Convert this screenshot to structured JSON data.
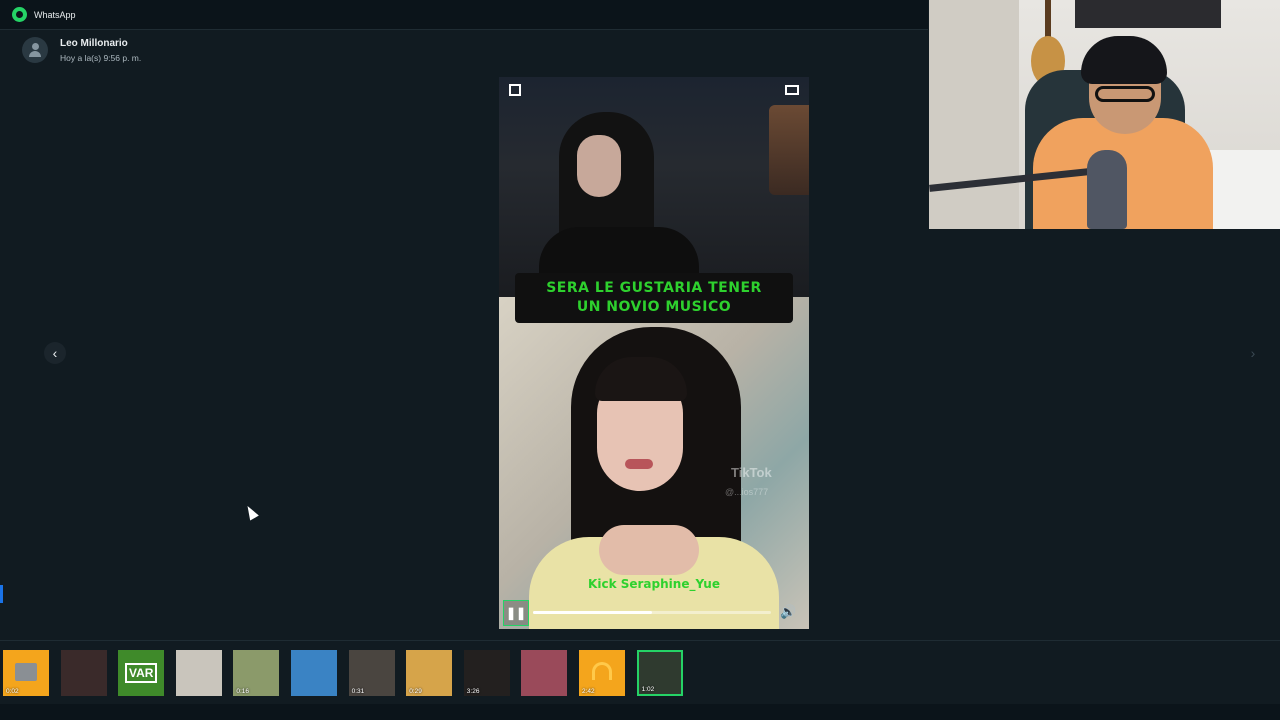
{
  "app": {
    "title": "WhatsApp"
  },
  "sender": {
    "name": "Leo Millonario",
    "time": "Hoy a la(s) 9:56 p. m."
  },
  "nav": {
    "prev_symbol": "‹",
    "next_symbol": "›"
  },
  "video": {
    "caption_line1": "SERA LE GUSTARIA TENER",
    "caption_line2": "UN NOVIO MUSICO",
    "watermark": "TikTok",
    "watermark_user": "@...ios777",
    "overlay_text": "Kick Seraphine_Yue",
    "playing": true,
    "progress": 0.5,
    "pause_symbol": "❚❚",
    "volume_symbol": "🔊"
  },
  "thumbnails": [
    {
      "kind": "image",
      "duration": "0:02",
      "color": "#f4a51c"
    },
    {
      "kind": "video",
      "duration": "",
      "color": "#3a2a2a"
    },
    {
      "kind": "image",
      "duration": "",
      "color": "#3f8a2a",
      "label": "VAR"
    },
    {
      "kind": "video",
      "duration": "",
      "color": "#c9c5bc"
    },
    {
      "kind": "video",
      "duration": "0:16",
      "color": "#8b9a6a"
    },
    {
      "kind": "video",
      "duration": "",
      "color": "#3a83c4"
    },
    {
      "kind": "video",
      "duration": "0:31",
      "color": "#4a4540"
    },
    {
      "kind": "video",
      "duration": "0:29",
      "color": "#d6a44a"
    },
    {
      "kind": "video",
      "duration": "3:26",
      "color": "#23201f"
    },
    {
      "kind": "video",
      "duration": "",
      "color": "#9a4a5a"
    },
    {
      "kind": "audio",
      "duration": "2:42",
      "color": "#f4a51c"
    },
    {
      "kind": "video",
      "duration": "1:02",
      "color": "#2f3a2f",
      "active": true
    }
  ],
  "colors": {
    "accent": "#25d366",
    "caption": "#2ed12e",
    "background": "#111b21"
  }
}
